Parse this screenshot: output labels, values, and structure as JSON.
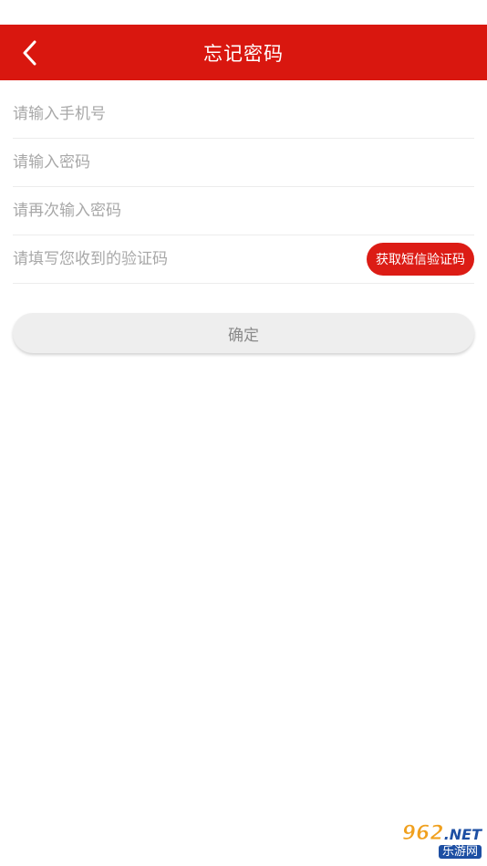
{
  "nav": {
    "title": "忘记密码",
    "back_icon": "chevron-left-icon",
    "background_color": "#d9170f"
  },
  "form": {
    "phone_placeholder": "请输入手机号",
    "password_placeholder": "请输入密码",
    "confirm_password_placeholder": "请再次输入密码",
    "code_placeholder": "请填写您收到的验证码",
    "sms_button_label": "获取短信验证码",
    "sms_button_color": "#dc1c15"
  },
  "confirm_button_label": "确定",
  "watermark": {
    "number": "962",
    "suffix": ".NET",
    "caption": "乐游网"
  }
}
